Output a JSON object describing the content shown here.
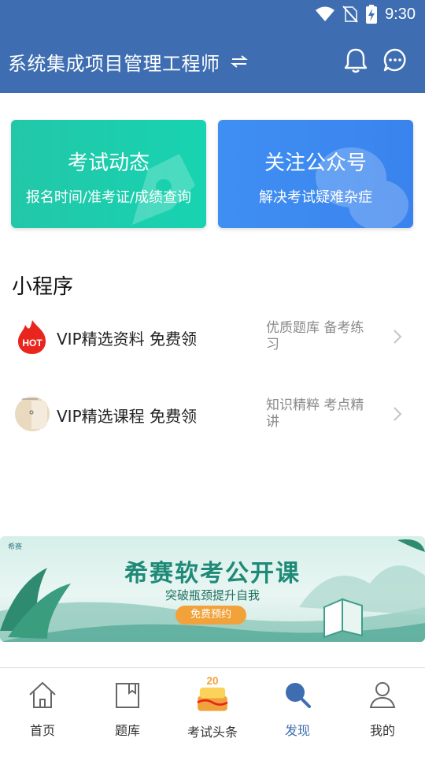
{
  "status_bar": {
    "time": "9:30"
  },
  "header": {
    "title": "系统集成项目管理工程师",
    "switch_icon": "swap-arrows-icon",
    "bell_icon": "bell-icon",
    "chat_icon": "chat-bubble-icon"
  },
  "cards": [
    {
      "title": "考试动态",
      "subtitle": "报名时间/准考证/成绩查询",
      "color": "#1fcfae"
    },
    {
      "title": "关注公众号",
      "subtitle": "解决考试疑难杂症",
      "color": "#3d8af1"
    }
  ],
  "mini_programs": {
    "title": "小程序",
    "items": [
      {
        "name": "VIP精选资料  免费领",
        "desc": "优质题库  备考练习",
        "icon": "hot-flame-icon"
      },
      {
        "name": "VIP精选课程  免费领",
        "desc": "知识精粹  考点精讲",
        "icon": "course-avatar-icon"
      }
    ]
  },
  "banner": {
    "logo": "希赛",
    "title": "希赛软考公开课",
    "subtitle": "突破瓶颈提升自我",
    "button": "免费预约"
  },
  "tabs": [
    {
      "label": "首页",
      "icon": "home-icon",
      "active": false
    },
    {
      "label": "题库",
      "icon": "question-bank-icon",
      "active": false
    },
    {
      "label": "考试头条",
      "icon": "cake-icon",
      "active": false
    },
    {
      "label": "发现",
      "icon": "search-icon",
      "active": true
    },
    {
      "label": "我的",
      "icon": "user-icon",
      "active": false
    }
  ],
  "colors": {
    "primary": "#3e6eb1",
    "exam_card": "#1fcfae",
    "follow_card": "#3d8af1",
    "banner_btn": "#f2a23a"
  }
}
